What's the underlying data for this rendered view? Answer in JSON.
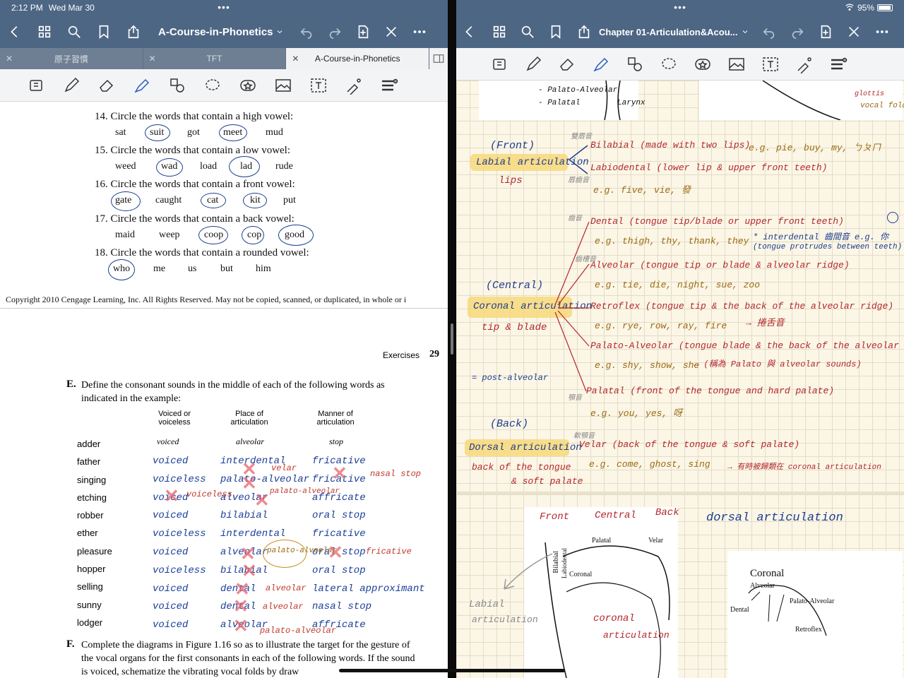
{
  "status": {
    "time": "2:12 PM",
    "date": "Wed Mar 30",
    "wifi": "wifi-icon",
    "battery": "95%"
  },
  "left": {
    "title": "A-Course-in-Phonetics",
    "tabs": [
      "原子習慣",
      "TFT",
      "A-Course-in-Phonetics"
    ],
    "questions": [
      {
        "num": "14.",
        "text": "Circle the words that contain a high vowel:",
        "words": [
          "sat",
          "suit",
          "got",
          "meet",
          "mud"
        ]
      },
      {
        "num": "15.",
        "text": "Circle the words that contain a low vowel:",
        "words": [
          "weed",
          "wad",
          "load",
          "lad",
          "rude"
        ]
      },
      {
        "num": "16.",
        "text": "Circle the words that contain a front vowel:",
        "words": [
          "gate",
          "caught",
          "cat",
          "kit",
          "put"
        ]
      },
      {
        "num": "17.",
        "text": "Circle the words that contain a back vowel:",
        "words": [
          "maid",
          "weep",
          "coop",
          "cop",
          "good"
        ]
      },
      {
        "num": "18.",
        "text": "Circle the words that contain a rounded vowel:",
        "words": [
          "who",
          "me",
          "us",
          "but",
          "him"
        ]
      }
    ],
    "copyright": "Copyright 2010 Cengage Learning, Inc. All Rights Reserved. May not be copied, scanned, or duplicated, in whole or i",
    "page_header": "Exercises",
    "page_number": "29",
    "section_e": {
      "letter": "E.",
      "text": "Define the consonant sounds in the middle of each of the following words as indicated in the example:",
      "col_voicing": "Voiced or voiceless",
      "col_place": "Place of articulation",
      "col_manner": "Manner of articulation",
      "example": {
        "voicing": "voiced",
        "place": "alveolar",
        "manner": "stop"
      },
      "words": [
        "adder",
        "father",
        "singing",
        "etching",
        "robber",
        "ether",
        "pleasure",
        "hopper",
        "selling",
        "sunny",
        "lodger"
      ],
      "voicing_answers": [
        "voiced",
        "voiceless",
        "voiced",
        "voiced",
        "voiceless",
        "voiced",
        "voiceless",
        "voiced",
        "voiced",
        "voiced"
      ],
      "place_answers": [
        "interdental",
        "palato-alveolar",
        "alveolar",
        "bilabial",
        "interdental",
        "alveolar",
        "bilabial",
        "dental",
        "dental",
        "alveolar"
      ],
      "manner_answers": [
        "fricative",
        "fricative",
        "affricate",
        "oral stop",
        "fricative",
        "oral stop",
        "oral stop",
        "lateral approximant",
        "nasal stop",
        "affricate"
      ],
      "corrections": [
        "velar",
        "nasal stop",
        "voiceless",
        "palato-alveolar",
        "palato-alveolar",
        "fricative",
        "alveolar",
        "alveolar",
        "palato-alveolar"
      ]
    },
    "section_f": {
      "letter": "F.",
      "text": "Complete the diagrams in Figure 1.16 so as to illustrate the target for the gesture of the vocal organs for the first consonants in each of the following words. If the sound is voiced, schematize the vibrating vocal folds by draw"
    }
  },
  "right": {
    "title": "Chapter 01-Articulation&Acou...",
    "notes_top": [
      "- Palato-Alveolar",
      "- Palatal",
      "Larynx",
      "glottis",
      "vocal folds"
    ],
    "front": {
      "label": "(Front)",
      "heading": "Labial articulation",
      "sub": "lips",
      "bilabial": "Bilabial (made with two lips)",
      "bilabial_eg": "e.g. pie, buy, my, ㄅㄆㄇ",
      "labiodental": "Labiodental (lower lip & upper front teeth)",
      "labiodental_eg": "e.g. five, vie, 發",
      "zh1": "雙唇音",
      "zh2": "唇齒音"
    },
    "central": {
      "label": "(Central)",
      "heading": "Coronal articulation",
      "sub": "tip & blade",
      "dental": "Dental (tongue tip/blade or upper front teeth)",
      "dental_eg": "e.g. thigh, thy, thank, they",
      "interdental": "* interdental 齒間音 e.g. 你",
      "interdental2": "(tongue protrudes between teeth)",
      "alveolar": "Alveolar (tongue tip or blade & alveolar ridge)",
      "alveolar_eg": "e.g. tie, die, night, sue, zoo",
      "retroflex": "Retroflex (tongue tip & the back of the alveolar ridge)",
      "retroflex_eg": "e.g. rye, row, ray, fire",
      "retroflex_zh": "→ 捲舌音",
      "palato": "Palato-Alveolar (tongue blade & the back of the alveolar ridge)",
      "palato_eg": "e.g. shy, show, she",
      "palato_note": "→ (稱為 Palato 與 alveolar sounds)",
      "palatal": "Palatal (front of the tongue and hard palate)",
      "palatal_eg": "e.g. you, yes, 呀",
      "post": "= post-alveolar",
      "zh_dental": "齒音",
      "zh_alv": "齒槽音",
      "zh_palatal": "顎音"
    },
    "back": {
      "label": "(Back)",
      "heading": "Dorsal articulation",
      "sub1": "back of the tongue",
      "sub2": "& soft palate",
      "velar": "Velar (back of the tongue & soft palate)",
      "velar_eg": "e.g. come, ghost, sing",
      "velar_note": "→ 有時被歸類在 coronal articulation",
      "zh": "軟顎音"
    },
    "diagram": {
      "front": "Front",
      "central": "Central",
      "back": "Back",
      "dorsal": "dorsal articulation",
      "palatal": "Palatal",
      "velar": "Velar",
      "bilabial": "Bilabial",
      "labiodental": "Labiodental",
      "coronal": "Coronal",
      "labial": "Labial",
      "labial2": "articulation",
      "coronal_hw": "coronal",
      "coronal_hw2": "articulation",
      "coronal_big": "Coronal",
      "alveolar": "Alveolar",
      "dental": "Dental",
      "palato_alveolar": "Palato-Alveolar",
      "retroflex": "Retroflex"
    }
  }
}
